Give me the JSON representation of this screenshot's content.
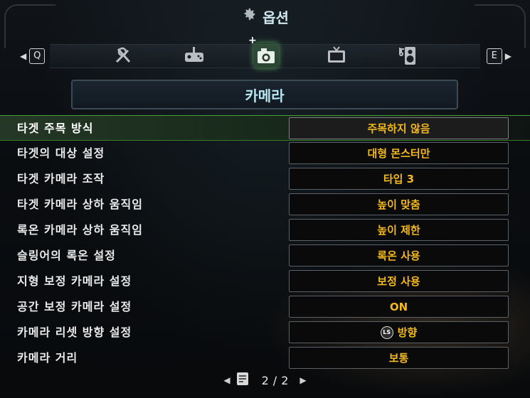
{
  "header": {
    "title": "옵션",
    "icon": "gear-icon"
  },
  "tabs": {
    "prev_key": "Q",
    "next_key": "E",
    "items": [
      {
        "icon": "tools-icon",
        "active": false
      },
      {
        "icon": "gamepad-icon",
        "active": false
      },
      {
        "icon": "camera-icon",
        "active": true
      },
      {
        "icon": "display-icon",
        "active": false
      },
      {
        "icon": "speaker-icon",
        "active": false
      }
    ]
  },
  "section": {
    "title": "카메라"
  },
  "settings": [
    {
      "label": "타겟 주목 방식",
      "value": "주목하지 않음",
      "selected": true
    },
    {
      "label": "타겟의 대상 설정",
      "value": "대형 몬스터만"
    },
    {
      "label": "타겟 카메라 조작",
      "value": "타입 3"
    },
    {
      "label": "타겟 카메라 상하 움직임",
      "value": "높이 맞춤"
    },
    {
      "label": "록온 카메라 상하 움직임",
      "value": "높이 제한"
    },
    {
      "label": "슬링어의 록온 설정",
      "value": "록온 사용"
    },
    {
      "label": "지형 보정 카메라 설정",
      "value": "보정 사용"
    },
    {
      "label": "공간 보정 카메라 설정",
      "value": "ON"
    },
    {
      "label": "카메라 리셋 방향 설정",
      "value": "방향",
      "value_icon": "LS"
    },
    {
      "label": "카메라 거리",
      "value": "보통"
    }
  ],
  "pager": {
    "current": "2",
    "separator": "/",
    "total": "2"
  },
  "colors": {
    "value_text": "#f2b81d",
    "section_text": "#b6e8f2",
    "selected_border": "#4a9c3a"
  }
}
